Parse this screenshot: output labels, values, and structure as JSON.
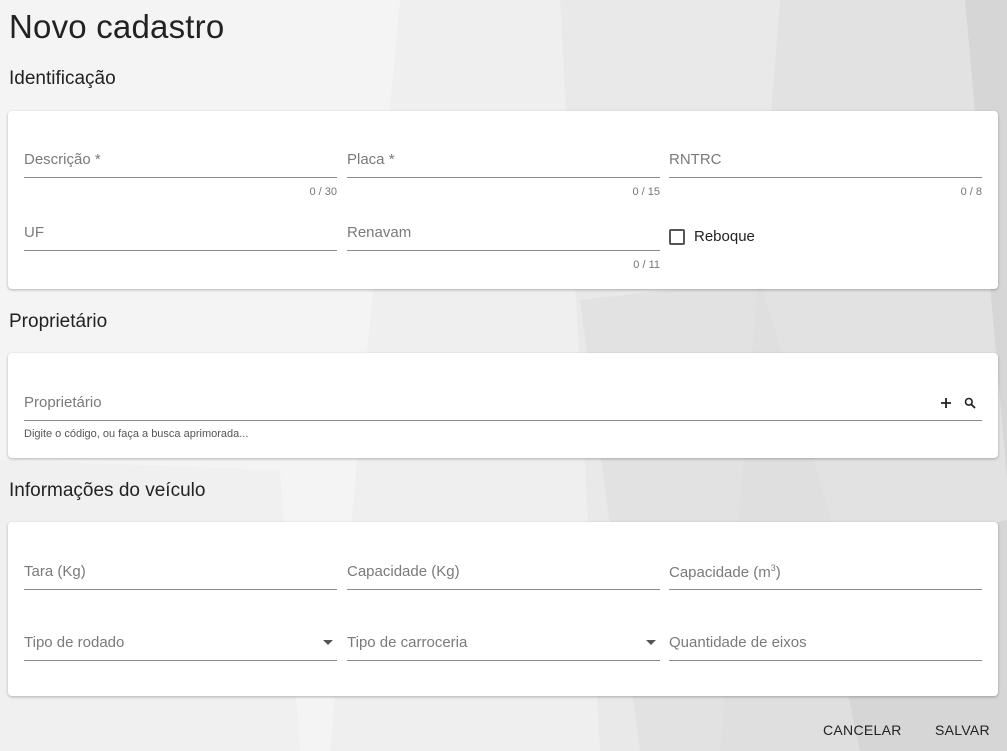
{
  "page": {
    "title": "Novo cadastro"
  },
  "identificacao": {
    "title": "Identificação",
    "descricao": {
      "label": "Descrição *",
      "counter": "0 / 30"
    },
    "placa": {
      "label": "Placa *",
      "counter": "0 / 15"
    },
    "rntrc": {
      "label": "RNTRC",
      "counter": "0 / 8"
    },
    "uf": {
      "label": "UF"
    },
    "renavam": {
      "label": "Renavam",
      "counter": "0 / 11"
    },
    "reboque": {
      "label": "Reboque",
      "checked": false
    }
  },
  "proprietario": {
    "title": "Proprietário",
    "field": {
      "label": "Proprietário",
      "hint": "Digite o código, ou faça a busca aprimorada..."
    },
    "icons": {
      "add": "plus-icon",
      "search": "search-icon"
    }
  },
  "veiculo": {
    "title": "Informações do veículo",
    "tara": {
      "label": "Tara (Kg)"
    },
    "capacidade_kg": {
      "label": "Capacidade (Kg)"
    },
    "capacidade_m3": {
      "label": "Capacidade (m",
      "unit_sup": "3",
      "label_end": ")"
    },
    "tipo_rodado": {
      "label": "Tipo de rodado"
    },
    "tipo_carroceria": {
      "label": "Tipo de carroceria"
    },
    "quantidade_eixos": {
      "label": "Quantidade de eixos"
    }
  },
  "footer": {
    "cancel_label": "CANCELAR",
    "save_label": "SALVAR"
  },
  "colors": {
    "background": "#f2f2f2",
    "card": "#ffffff",
    "label": "#7a7a7a",
    "text": "#222222"
  }
}
